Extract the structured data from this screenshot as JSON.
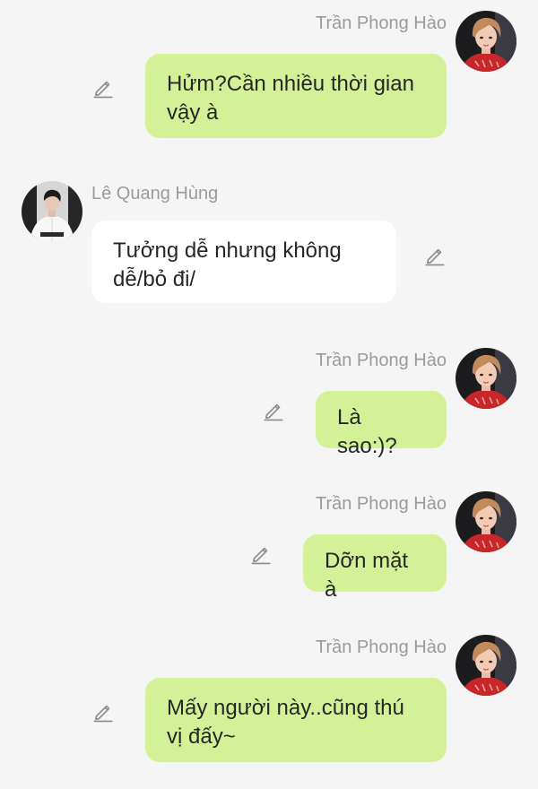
{
  "messages": [
    {
      "id": "m1",
      "sender": "Trần Phong Hào",
      "text": "Hửm?Cần nhiều thời gian vậy à",
      "side": "right"
    },
    {
      "id": "m2",
      "sender": "Lê Quang Hùng",
      "text": "Tưởng dễ nhưng không dễ/bỏ đi/",
      "side": "left"
    },
    {
      "id": "m3",
      "sender": "Trần Phong Hào",
      "text": "Là sao:)?",
      "side": "right"
    },
    {
      "id": "m4",
      "sender": "Trần Phong Hào",
      "text": "Dỡn mặt à",
      "side": "right"
    },
    {
      "id": "m5",
      "sender": "Trần Phong Hào",
      "text": "Mấy người này..cũng thú vị đấy~",
      "side": "right"
    }
  ],
  "icons": {
    "edit": "pencil-edit-icon",
    "avatar_right": "avatar-tran-phong-hao",
    "avatar_left": "avatar-le-quang-hung"
  },
  "colors": {
    "background": "#f5f5f5",
    "my_bubble": "#d5f198",
    "their_bubble": "#ffffff",
    "sender_name": "#9b9b9b",
    "message_text": "#262626",
    "edit_icon": "#8a8a8a"
  }
}
